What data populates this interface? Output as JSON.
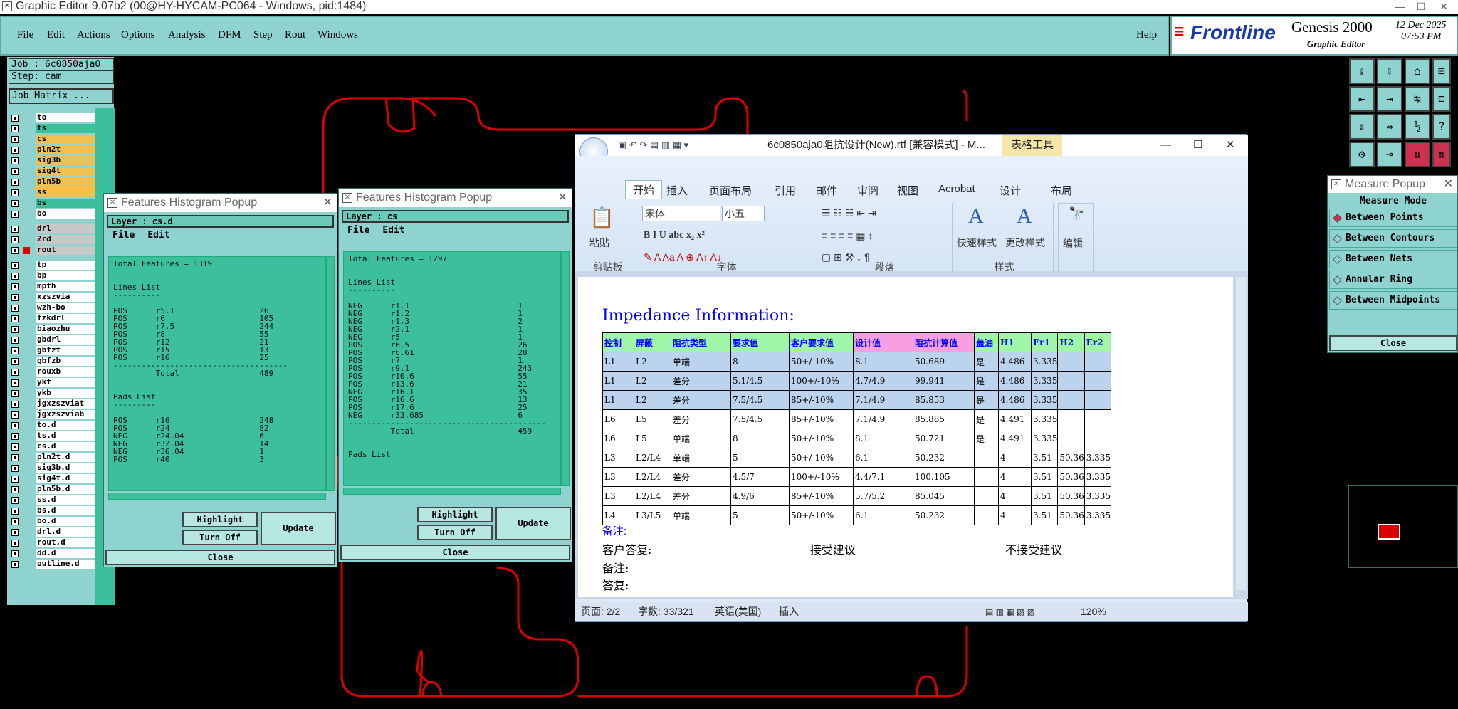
{
  "window": {
    "title": "Graphic Editor 9.07b2 (00@HY-HYCAM-PC064 - Windows, pid:1484)"
  },
  "menu": {
    "items": [
      "File",
      "Edit",
      "Actions",
      "Options",
      "Analysis",
      "DFM",
      "Step",
      "Rout",
      "Windows"
    ],
    "help": "Help"
  },
  "logo": {
    "brand": "Frontline",
    "product": "Genesis 2000",
    "subtitle": "Graphic Editor",
    "date": "12 Dec 2025",
    "time": "07:53 PM"
  },
  "job": {
    "job": "Job : 6c0850aja0",
    "step": "Step: cam",
    "matrix_button": "Job Matrix ..."
  },
  "layers": {
    "board": [
      {
        "name": "to",
        "color": "#ffffff"
      },
      {
        "name": "ts",
        "color": "#3bbf9c"
      },
      {
        "name": "cs",
        "color": "#f0c050"
      },
      {
        "name": "pln2t",
        "color": "#f0c050"
      },
      {
        "name": "sig3b",
        "color": "#f0c050"
      },
      {
        "name": "sig4t",
        "color": "#f0c050"
      },
      {
        "name": "pln5b",
        "color": "#f0c050"
      },
      {
        "name": "ss",
        "color": "#f0c050"
      },
      {
        "name": "bs",
        "color": "#3bbf9c"
      },
      {
        "name": "bo",
        "color": "#ffffff"
      }
    ],
    "drill": [
      {
        "name": "drl",
        "color": "#c8c8c8"
      },
      {
        "name": "2rd",
        "color": "#c8c8c8"
      },
      {
        "name": "rout",
        "color": "#c8c8c8"
      }
    ],
    "misc": [
      "tp",
      "bp",
      "mpth",
      "xzszvia",
      "wzh-bo",
      "fzkdrl",
      "biaozhu",
      "gbdrl",
      "gbfzt",
      "gbfzb",
      "rouxb",
      "ykt",
      "ykb",
      "jgxzszviat",
      "jgxzszviab",
      "to.d",
      "ts.d",
      "cs.d",
      "pln2t.d",
      "sig3b.d",
      "sig4t.d",
      "pln5b.d",
      "ss.d",
      "bs.d",
      "bo.d",
      "drl.d",
      "rout.d",
      "dd.d",
      "outline.d"
    ]
  },
  "hist1": {
    "title": "Features Histogram Popup",
    "layer": "Layer :  cs.d",
    "menu": [
      "File",
      "Edit"
    ],
    "text": "Total Features = 1319\n\n\nLines List\n----------\n\nPOS      r5.1                  26\nPOS      r6                    105\nPOS      r7.5                  244\nPOS      r8                    55\nPOS      r12                   21\nPOS      r15                   13\nPOS      r16                   25\n-------------------------------------\n         Total                 489\n\n\nPads List\n---------\n\nPOS      r16                   248\nPOS      r24                   82\nNEG      r24.04                6\nNEG      r32.04                14\nNEG      r36.04                1\nPOS      r40                   3",
    "buttons": {
      "highlight": "Highlight",
      "turnoff": "Turn Off",
      "update": "Update",
      "close": "Close"
    }
  },
  "hist2": {
    "title": "Features Histogram Popup",
    "layer": "Layer :  cs",
    "menu": [
      "File",
      "Edit"
    ],
    "text": "Total Features = 1297\n\n\nLines List\n----------\n\nNEG      r1.1                       1\nNEG      r1.2                       1\nNEG      r1.3                       2\nNEG      r2.1                       1\nNEG      r5                         1\nPOS      r6.5                       26\nPOS      r6.61                      28\nPOS      r7                         1\nPOS      r9.1                       243\nPOS      r10.6                      55\nPOS      r13.6                      21\nNEG      r16.1                      35\nPOS      r16.6                      13\nPOS      r17.6                      25\nNEG      r33.685                    6\n------------------------------------------\n         Total                      459\n\n\nPads List",
    "buttons": {
      "highlight": "Highlight",
      "turnoff": "Turn Off",
      "update": "Update",
      "close": "Close"
    }
  },
  "word": {
    "title": "6c0850aja0阻抗设计(New).rtf [兼容模式] - M...",
    "tools_tab": "表格工具",
    "tabs": [
      "开始",
      "插入",
      "页面布局",
      "引用",
      "邮件",
      "审阅",
      "视图",
      "Acrobat",
      "设计",
      "布局"
    ],
    "font": "宋体",
    "size": "小五",
    "groups": [
      "剪贴板",
      "字体",
      "段落",
      "样式",
      "编辑"
    ],
    "paste": "粘贴",
    "quick_style": "快速样式",
    "change_style": "更改样式",
    "edit": "编辑",
    "doc_heading": "Impedance Information:",
    "table_header": [
      "控制",
      "屏蔽",
      "阻抗类型",
      "要求值",
      "客户要求值",
      "设计值",
      "阻抗计算值",
      "盖油",
      "H1",
      "Er1",
      "H2",
      "Er2"
    ],
    "rows": [
      [
        "L1",
        "L2",
        "单端",
        "8",
        "50+/-10%",
        "8.1",
        "50.689",
        "是",
        "4.486",
        "3.335",
        "",
        ""
      ],
      [
        "L1",
        "L2",
        "差分",
        "5.1/4.5",
        "100+/-10%",
        "4.7/4.9",
        "99.941",
        "是",
        "4.486",
        "3.335",
        "",
        ""
      ],
      [
        "L1",
        "L2",
        "差分",
        "7.5/4.5",
        "85+/-10%",
        "7.1/4.9",
        "85.853",
        "是",
        "4.486",
        "3.335",
        "",
        ""
      ],
      [
        "L6",
        "L5",
        "差分",
        "7.5/4.5",
        "85+/-10%",
        "7.1/4.9",
        "85.885",
        "是",
        "4.491",
        "3.335",
        "",
        ""
      ],
      [
        "L6",
        "L5",
        "单端",
        "8",
        "50+/-10%",
        "8.1",
        "50.721",
        "是",
        "4.491",
        "3.335",
        "",
        ""
      ],
      [
        "L3",
        "L2/L4",
        "单端",
        "5",
        "50+/-10%",
        "6.1",
        "50.232",
        "",
        "4",
        "3.51",
        "50.36",
        "3.335"
      ],
      [
        "L3",
        "L2/L4",
        "差分",
        "4.5/7",
        "100+/-10%",
        "4.4/7.1",
        "100.105",
        "",
        "4",
        "3.51",
        "50.36",
        "3.335"
      ],
      [
        "L3",
        "L2/L4",
        "差分",
        "4.9/6",
        "85+/-10%",
        "5.7/5.2",
        "85.045",
        "",
        "4",
        "3.51",
        "50.36",
        "3.335"
      ],
      [
        "L4",
        "L3/L5",
        "单端",
        "5",
        "50+/-10%",
        "6.1",
        "50.232",
        "",
        "4",
        "3.51",
        "50.36",
        "3.335"
      ]
    ],
    "note1": "备注:",
    "reply": "客户答复:",
    "accept": "接受建议",
    "reject": "不接受建议",
    "note2": "备注:",
    "reply2": "答复:",
    "status": {
      "page": "页面: 2/2",
      "words": "字数: 33/321",
      "lang": "英语(美国)",
      "mode": "插入",
      "zoom": "120%"
    }
  },
  "measure": {
    "title": "Measure Popup",
    "mode": "Measure Mode",
    "options": [
      "Between Points",
      "Between Contours",
      "Between Nets",
      "Annular Ring",
      "Between Midpoints"
    ],
    "close": "Close"
  }
}
